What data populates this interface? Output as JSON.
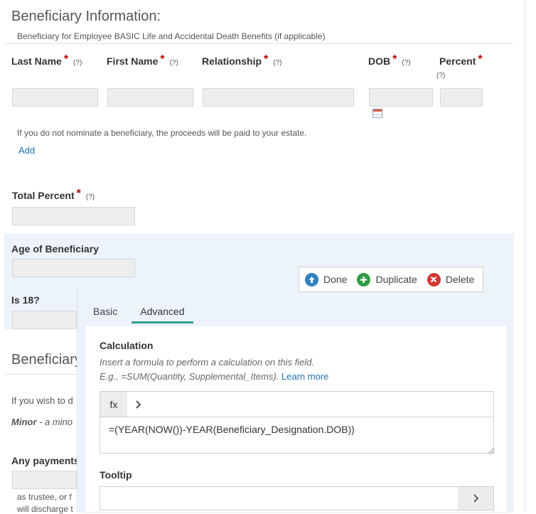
{
  "section1": {
    "title": "Beneficiary Information:",
    "subtitle": "Beneficiary for Employee BASIC Life and Accidental Death Benefits (if applicable)"
  },
  "fields": {
    "last_name": "Last Name",
    "first_name": "First Name",
    "relationship": "Relationship",
    "dob": "DOB",
    "percent": "Percent",
    "required_mark": "*",
    "help_mark": "(?)"
  },
  "estate_note": "If you do not nominate a beneficiary, the proceeds will be paid to your estate.",
  "add_link": "Add",
  "total_percent": "Total Percent",
  "age_of_beneficiary": "Age of Beneficiary",
  "is_18": "Is 18?",
  "section2": {
    "title": "Beneficiary",
    "text1": "If you wish to d",
    "minor_bold": "Minor",
    "minor_rest": " - a mino",
    "any_payments": "Any payments",
    "trustee": "as trustee, or f",
    "discharge": "will discharge t"
  },
  "toolbar": {
    "done": "Done",
    "duplicate": "Duplicate",
    "delete": "Delete"
  },
  "panel": {
    "tabs": [
      "Basic",
      "Advanced"
    ],
    "calc_heading": "Calculation",
    "calc_hint": "Insert a formula to perform a calculation on this field.",
    "calc_example": "E.g., =SUM(Quantity, Supplemental_Items).",
    "learn_more": "Learn more",
    "fx_label": "fx",
    "formula_value": "=(YEAR(NOW())-YEAR(Beneficiary_Designation.DOB))",
    "tooltip_heading": "Tooltip"
  },
  "colors": {
    "required": "#b50000",
    "link": "#1f6fb2",
    "tab_underline": "#2a9d8f",
    "panel_bg": "#edf3fb"
  }
}
